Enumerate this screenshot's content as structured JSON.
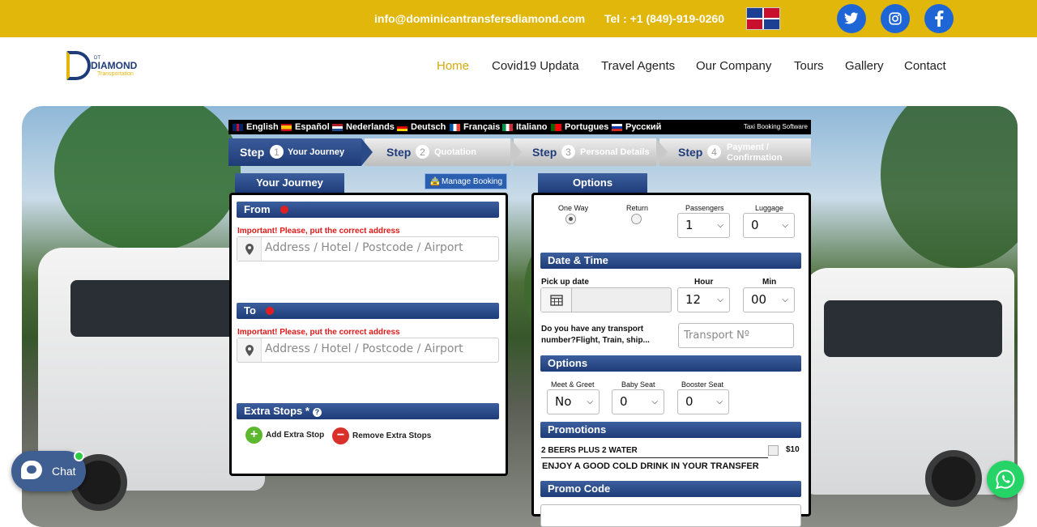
{
  "topbar": {
    "email": "info@dominicantransfersdiamond.com",
    "tel": "Tel : +1 (849)-919-0260",
    "social": [
      "twitter-icon",
      "instagram-icon",
      "facebook-icon"
    ],
    "color": "#e2b70b"
  },
  "logo": {
    "name": "DIAMOND",
    "sub": "Transportation",
    "sup": "DT"
  },
  "nav": {
    "items": [
      "Home",
      "Covid19 Updata",
      "Travel Agents",
      "Our Company",
      "Tours",
      "Gallery",
      "Contact"
    ],
    "active": "Home",
    "active_color": "#d4a90a"
  },
  "booking": {
    "languages": [
      "English",
      "Español",
      "Nederlands",
      "Deutsch",
      "Français",
      "Italiano",
      "Portugues",
      "Русский"
    ],
    "software": "Taxi Booking Software",
    "steps": [
      {
        "label": "Step",
        "num": "1",
        "text": "Your Journey"
      },
      {
        "label": "Step",
        "num": "2",
        "text": "Quotation"
      },
      {
        "label": "Step",
        "num": "3",
        "text": "Personal Details"
      },
      {
        "label": "Step",
        "num": "4",
        "text": "Payment /",
        "text2": "Confirmation"
      }
    ],
    "journey_title": "Your Journey",
    "manage_booking": "Manage Booking",
    "options_title": "Options",
    "from": {
      "title": "From",
      "warning": "Important! Please, put the correct address",
      "placeholder": "Address / Hotel / Postcode / Airport"
    },
    "to": {
      "title": "To",
      "warning": "Important! Please, put the correct address",
      "placeholder": "Address / Hotel / Postcode / Airport"
    },
    "extra": {
      "title": "Extra Stops *",
      "add": "Add Extra Stop",
      "remove": "Remove Extra Stops"
    },
    "trip": {
      "one_way": "One Way",
      "return": "Return",
      "passengers": "Passengers",
      "luggage": "Luggage",
      "passengers_value": "1",
      "luggage_value": "0"
    },
    "datetime": {
      "title": "Date & Time",
      "pickup": "Pick up date",
      "hour": "Hour",
      "min": "Min",
      "hour_value": "12",
      "min_value": "00",
      "transport_q1": "Do you have any transport",
      "transport_q2": "number?Flight, Train, ship...",
      "transport_placeholder": "Transport Nº"
    },
    "options": {
      "title": "Options",
      "meet": "Meet & Greet",
      "baby": "Baby Seat",
      "booster": "Booster Seat",
      "meet_value": "No",
      "baby_value": "0",
      "booster_value": "0"
    },
    "promotions": {
      "title": "Promotions",
      "item": "2 BEERS PLUS 2 WATER",
      "price": "$10",
      "desc": "ENJOY A GOOD COLD DRINK IN YOUR TRANSFER"
    },
    "promo_code": {
      "title": "Promo Code"
    }
  },
  "chat": {
    "label": "Chat"
  }
}
